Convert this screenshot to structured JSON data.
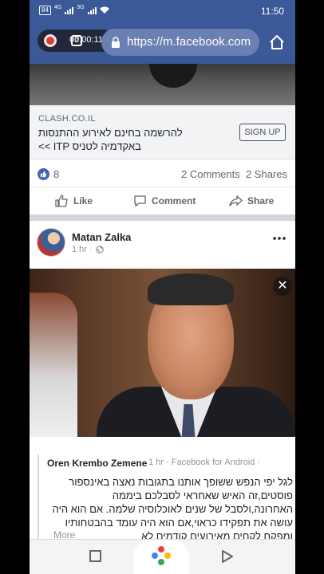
{
  "status_bar": {
    "battery": "84",
    "net1": "4G",
    "net2": "3G",
    "time": "11:50"
  },
  "browser": {
    "url": "https://m.facebook.com",
    "recording_time": "00:00:11",
    "tab_count": "2"
  },
  "ad": {
    "domain": "CLASH.CO.IL",
    "title_line1": "להרשמה בחינם לאירוע ההתנסות",
    "title_line2": "באקדמיה לטניס ITP >>",
    "cta_label": "SIGN UP"
  },
  "reactions": {
    "like_count": "8",
    "comments": "2 Comments",
    "shares": "2 Shares"
  },
  "actions": {
    "like_label": "Like",
    "comment_label": "Comment",
    "share_label": "Share"
  },
  "post": {
    "author": "Matan Zalka",
    "time": "1 hr ·"
  },
  "shared_comment": {
    "author": "Oren Krembo Zemene",
    "meta": "1 hr · Facebook for Android ·",
    "text": "לגל יפי הנפש ששופך אותנו בתגובות נאצה באינספור פוסטים,זה האיש שאחראי לסבלכם ביממה האחרונה,ולסבל של שנים לאוכלוסיה שלמה. אם הוא היה עושה את תפקידו כראוי,אם הוא היה עומד בהבטחותיו ומפקח לקחים מאירועים קודמים לא",
    "more_label": "More"
  },
  "colors": {
    "facebook_blue": "#3b5998",
    "like_blue": "#4267b2"
  }
}
